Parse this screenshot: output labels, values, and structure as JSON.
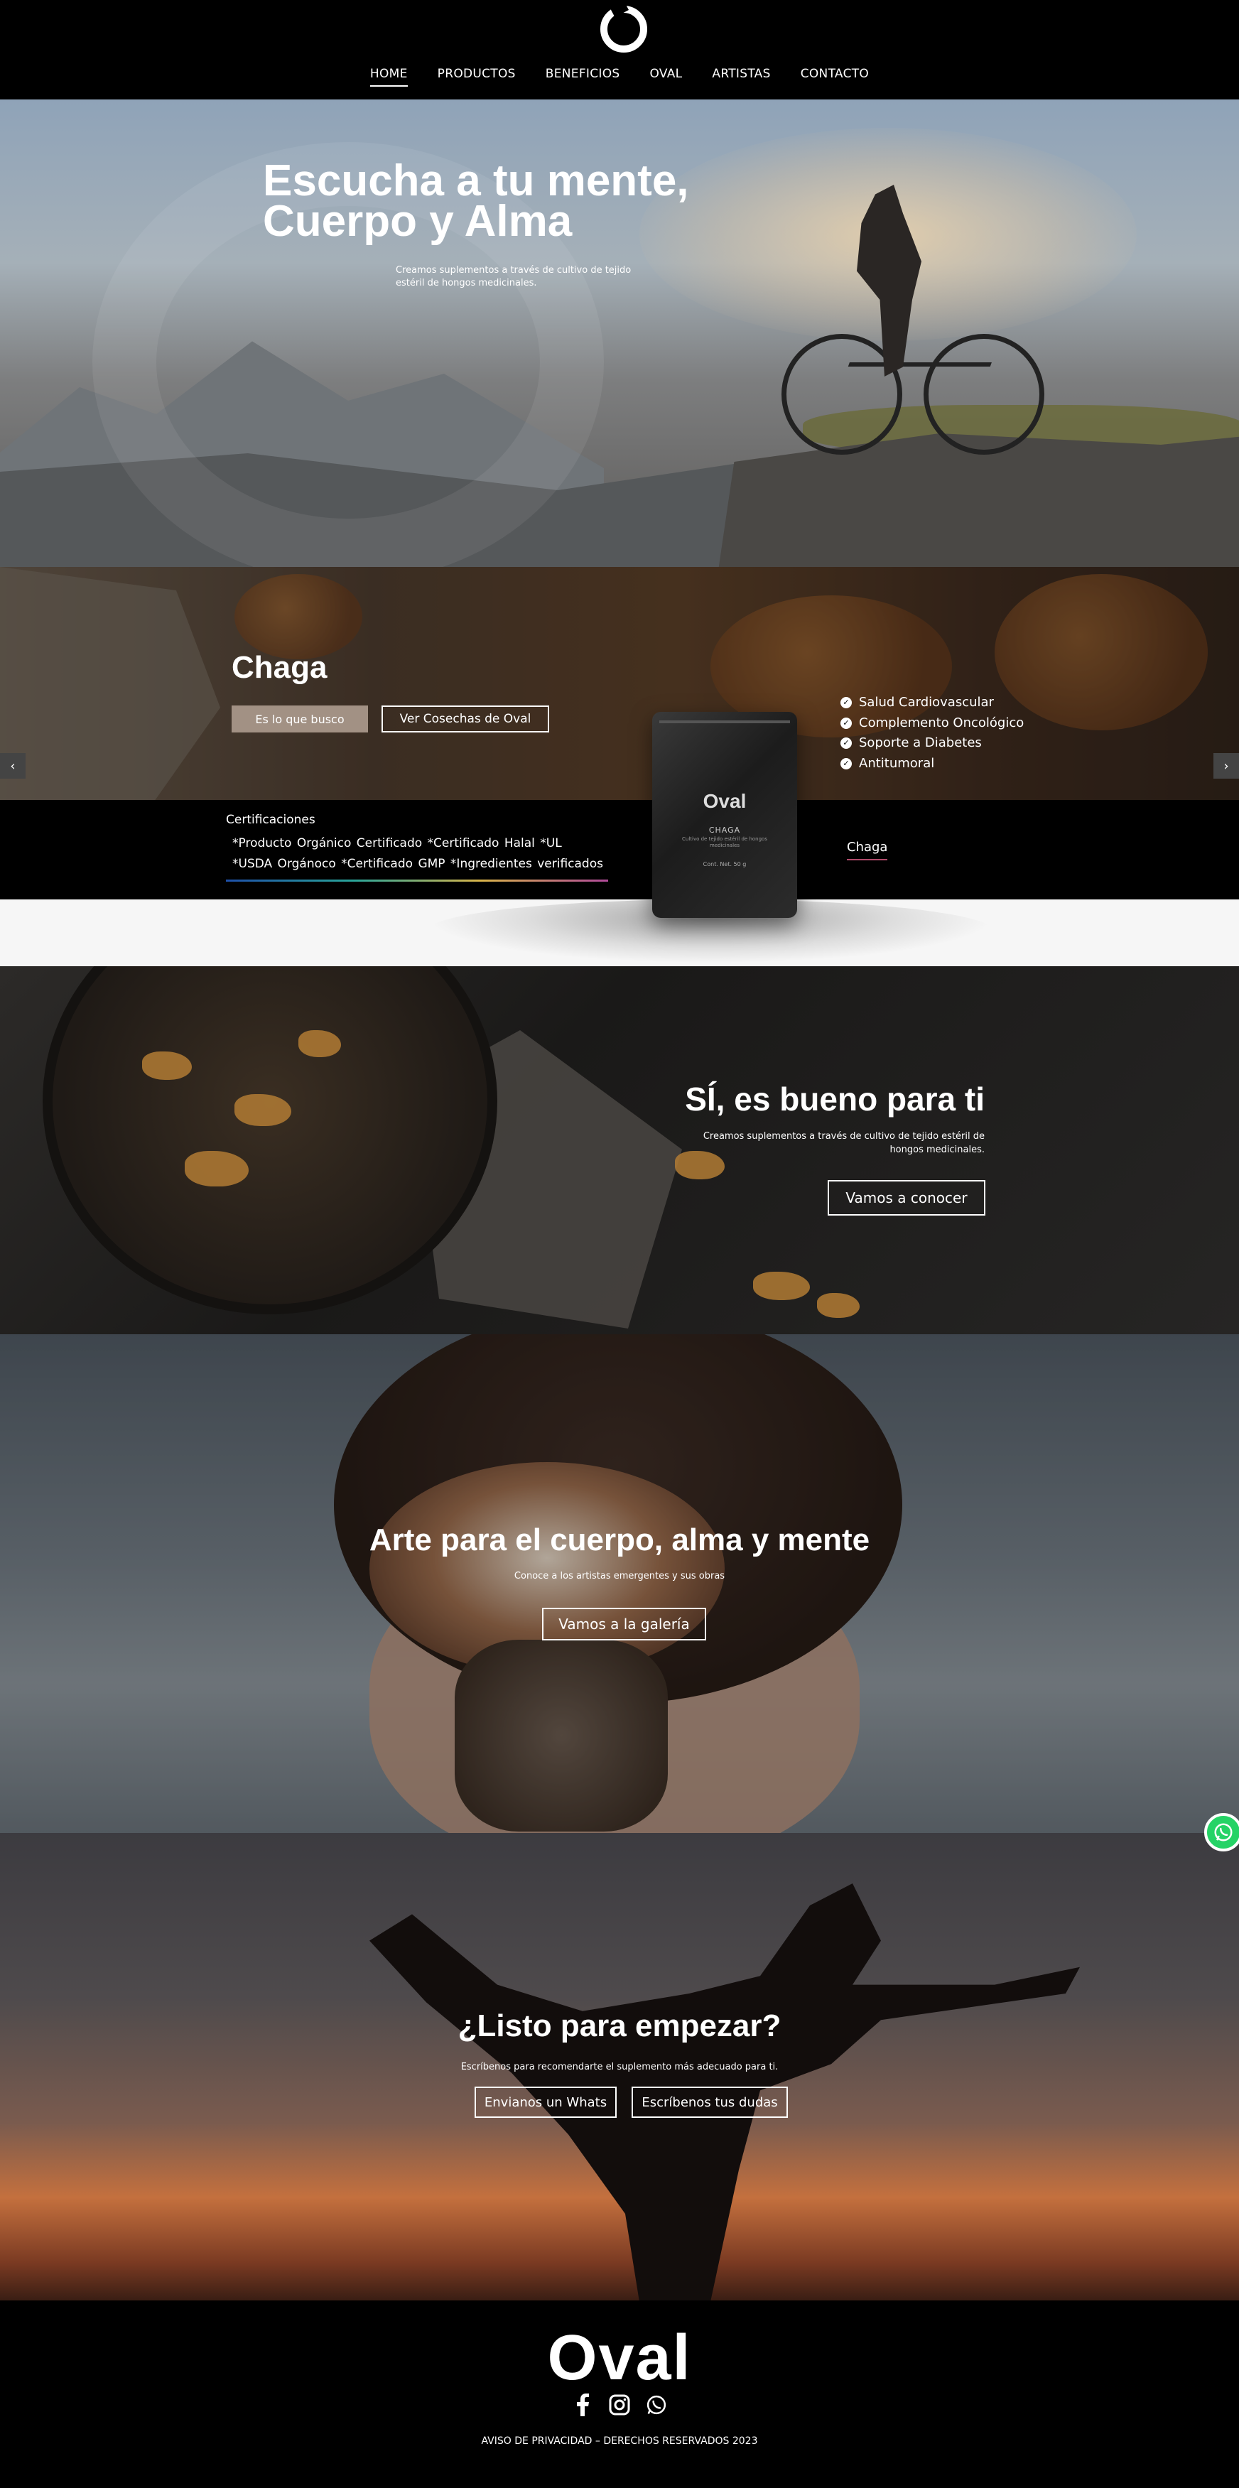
{
  "nav": {
    "items": [
      {
        "label": "HOME",
        "active": true
      },
      {
        "label": "PRODUCTOS"
      },
      {
        "label": "BENEFICIOS"
      },
      {
        "label": "OVAL"
      },
      {
        "label": "ARTISTAS"
      },
      {
        "label": "CONTACTO"
      }
    ]
  },
  "hero": {
    "title_line1": "Escucha a tu mente,",
    "title_line2": "Cuerpo y Alma",
    "subtitle": "Creamos suplementos a través de cultivo de tejido estéril de hongos medicinales."
  },
  "product": {
    "name": "Chaga",
    "primary_button": "Es lo que busco",
    "secondary_button": "Ver Cosechas de Oval",
    "benefits": [
      "Salud Cardiovascular",
      "Complemento Oncológico",
      "Soporte a Diabetes",
      "Antitumoral"
    ],
    "prev_icon": "chevron-left-icon",
    "next_icon": "chevron-right-icon",
    "bag": {
      "brand": "Oval",
      "name": "CHAGA",
      "small_text": "Cultivo de tejido estéril de hongos medicinales",
      "weight": "Cont. Net. 50 g"
    }
  },
  "certifications": {
    "title": "Certificaciones",
    "line1": "*Producto Orgánico Certificado  *Certificado Halal  *UL",
    "line2": "*USDA Orgánoco  *Certificado GMP  *Ingredientes verificados",
    "active_tab": "Chaga"
  },
  "bueno": {
    "title": "SÍ, es bueno para ti",
    "subtitle": "Creamos suplementos a través de cultivo de tejido estéril de hongos medicinales.",
    "button": "Vamos a conocer"
  },
  "arte": {
    "title": "Arte para el cuerpo, alma y mente",
    "subtitle": "Conoce a los artistas emergentes y sus obras",
    "button": "Vamos a la galería"
  },
  "listo": {
    "title": "¿Listo para empezar?",
    "subtitle": "Escríbenos para recomendarte el suplemento más adecuado para ti.",
    "button_whats": "Envianos un Whats",
    "button_dudas": "Escríbenos tus dudas"
  },
  "footer": {
    "logo": "Oval",
    "socials": [
      "facebook-icon",
      "instagram-icon",
      "whatsapp-icon"
    ],
    "legal": "AVISO DE PRIVACIDAD – DERECHOS RESERVADOS 2023"
  },
  "colors": {
    "background": "#000000",
    "button_fill": "#a29184",
    "whatsapp": "#25d366"
  }
}
